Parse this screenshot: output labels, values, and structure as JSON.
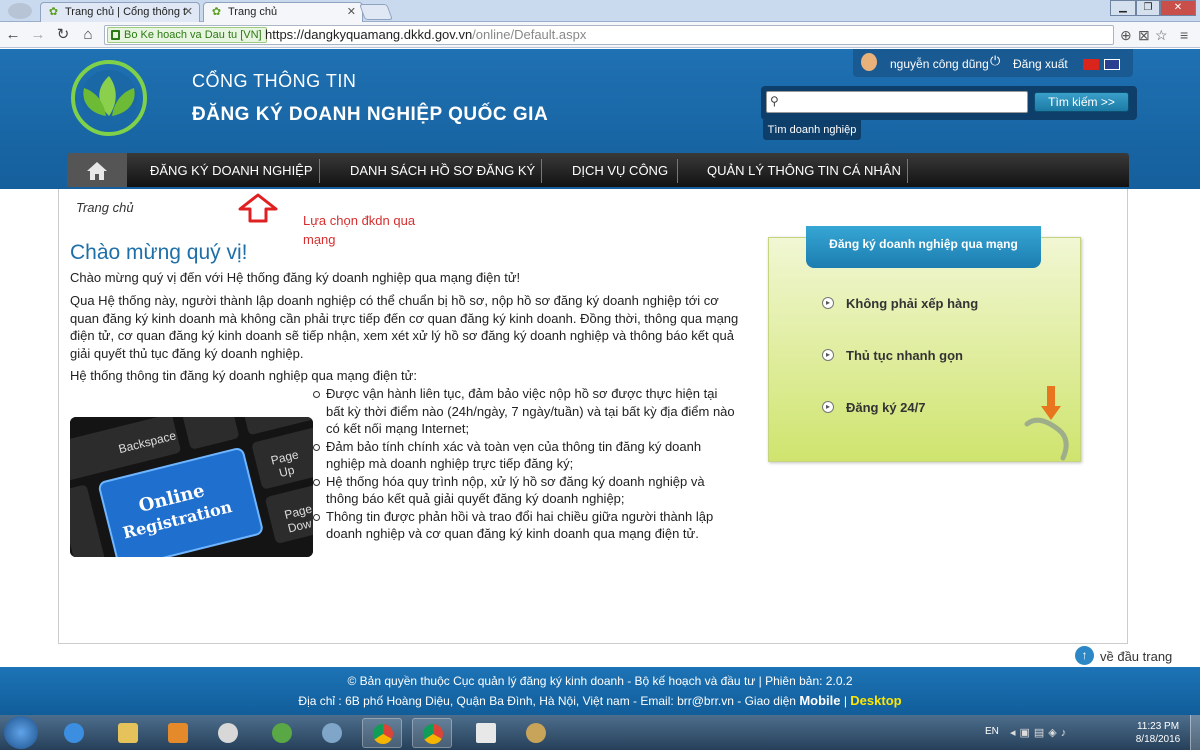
{
  "browser": {
    "tabs": [
      {
        "title": "Trang chủ | Cổng thông t",
        "active": false
      },
      {
        "title": "Trang chủ",
        "active": true
      }
    ],
    "secure_label": "Bo Ke hoach va Dau tu [VN]",
    "url_host": "https://dangkyquamang.dkkd.gov.vn",
    "url_path": "/online/Default.aspx"
  },
  "header": {
    "portal_sub": "CỔNG THÔNG TIN",
    "portal_title": "ĐĂNG KÝ DOANH NGHIỆP QUỐC GIA",
    "user_name": "nguyễn công dũng",
    "logout": "Đăng xuất",
    "search_placeholder": "",
    "search_button": "Tìm kiếm >>",
    "search_tab": "Tìm doanh nghiệp"
  },
  "nav": {
    "items": [
      "ĐĂNG KÝ DOANH NGHIỆP",
      "DANH SÁCH HỒ SƠ ĐĂNG KÝ",
      "DỊCH VỤ CÔNG",
      "QUẢN LÝ THÔNG TIN CÁ NHÂN"
    ]
  },
  "content": {
    "breadcrumb": "Trang chủ",
    "annotation": "Lựa chọn đkdn qua mạng",
    "welcome_title": "Chào mừng quý vị!",
    "p1": "Chào mừng quý vị đến với Hệ thống đăng ký doanh nghiệp qua mạng điện tử!",
    "p2": "Qua Hệ thống này, người thành lập doanh nghiệp có thể chuẩn bị hồ sơ, nộp hồ sơ đăng ký doanh nghiệp tới cơ quan đăng ký kinh doanh mà không cần phải trực tiếp đến cơ quan đăng ký kinh doanh. Đồng thời, thông qua mạng điện tử, cơ quan đăng ký kinh doanh sẽ tiếp nhận, xem xét xử lý hồ sơ đăng ký doanh nghiệp và thông báo kết quả giải quyết thủ tục đăng ký doanh nghiệp.",
    "p3": "Hệ thống thông tin đăng ký doanh nghiệp qua mạng điện tử:",
    "bullets": [
      "Được vận hành liên tục, đảm bảo việc nộp hồ sơ được thực hiện tại bất kỳ thời điểm nào (24h/ngày, 7 ngày/tuần) và tại bất kỳ địa điểm nào có kết nối mạng Internet;",
      "Đảm bảo tính chính xác và toàn vẹn của thông tin đăng ký doanh nghiệp mà doanh nghiệp trực tiếp đăng ký;",
      "Hệ thống hóa quy trình nộp, xử lý hồ sơ đăng ký doanh nghiệp và thông báo kết quả giải quyết đăng ký doanh nghiệp;",
      "Thông tin được phản hồi và trao đổi hai chiều giữa người thành lập doanh nghiệp và cơ quan đăng ký kinh doanh qua mạng điện tử."
    ],
    "image_text": {
      "line1": "Online",
      "line2": "Registration",
      "key_backspace": "Backspace",
      "key_pageup_1": "Page",
      "key_pageup_2": "Up",
      "key_pagedown_1": "Page",
      "key_pagedown_2": "Dow"
    }
  },
  "promo": {
    "title": "Đăng ký doanh nghiệp qua mạng",
    "items": [
      "Không phải xếp hàng",
      "Thủ tục nhanh gọn",
      "Đăng ký 24/7"
    ]
  },
  "footer": {
    "back_to_top": "về đầu trang",
    "copyright": "© Bản quyền thuộc Cục quản lý đăng ký kinh doanh - Bộ kế hoạch và đầu tư | Phiên bản: 2.0.2",
    "address": "Địa chỉ : 6B phố Hoàng Diệu, Quận Ba Đình, Hà Nội, Việt nam - Email:",
    "email": "brr@brr.vn",
    "ui_label": "- Giao diện",
    "mobile": "Mobile",
    "desktop": "Desktop"
  },
  "taskbar": {
    "lang": "EN",
    "time": "11:23 PM",
    "date": "8/18/2016"
  }
}
